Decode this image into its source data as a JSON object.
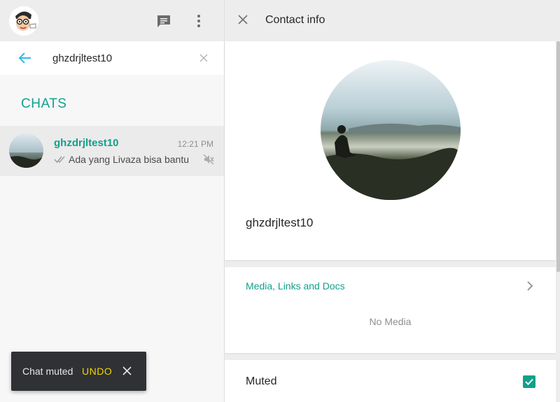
{
  "left": {
    "search": {
      "value": "ghzdrjltest10",
      "placeholder": ""
    },
    "section_label": "CHATS",
    "chat": {
      "name": "ghzdrjltest10",
      "time": "12:21 PM",
      "preview": "Ada yang Livaza bisa bantu",
      "status_icon": "double-check-icon",
      "muted_icon": "muted-speaker-icon"
    },
    "header_icons": [
      "new-chat-icon",
      "menu-icon"
    ]
  },
  "toast": {
    "text": "Chat muted",
    "action": "UNDO"
  },
  "right": {
    "title": "Contact info",
    "profile_name": "ghzdrjltest10",
    "media_label": "Media, Links and Docs",
    "no_media": "No Media",
    "muted_label": "Muted",
    "muted_checked": true
  },
  "colors": {
    "accent": "#12a08a",
    "header_bg": "#ededed",
    "toast_bg": "#2f3134",
    "undo": "#f2d600"
  }
}
